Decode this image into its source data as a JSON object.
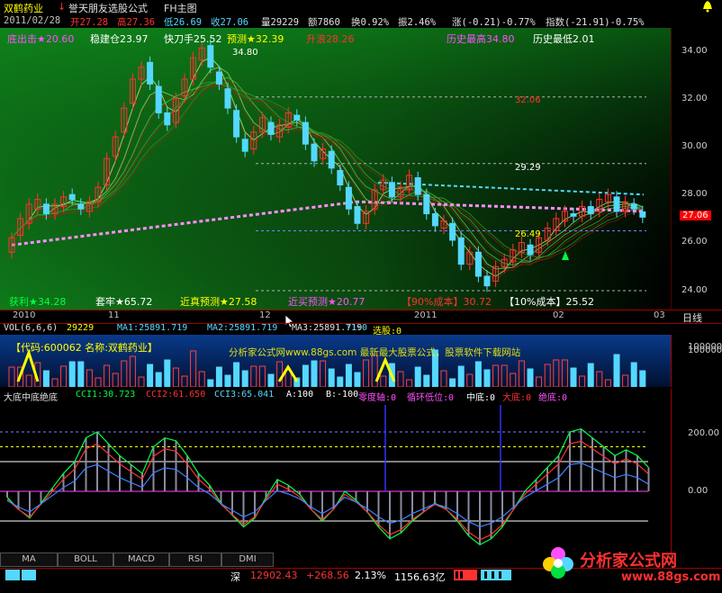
{
  "top": {
    "stock_name": "双鹤药业",
    "formula_title": "誉天朋友选股公式",
    "chart_mode": "FH主图",
    "alarm_icon": "bell-icon"
  },
  "quote": {
    "date": "2011/02/28",
    "open": "开27.28",
    "high": "高27.36",
    "low": "低26.69",
    "close": "收27.06",
    "volume": "量29229",
    "amount": "额7860",
    "turnover": "换0.92%",
    "amplitude": "振2.46%",
    "change": "涨(-0.21)-0.77%",
    "index": "指数(-21.91)-0.75%"
  },
  "main_labels": {
    "l1": "底出击★20.60",
    "l2": "稳建仓23.97",
    "l3": "快刀手25.52",
    "l4": "预测★32.39",
    "l5": "升浪28.26",
    "l6": "历史最高34.80",
    "l7": "历史最低2.01",
    "peak": "34.80",
    "lvl1": "32.06",
    "lvl2": "29.29",
    "lvl3": "26.49",
    "b1": "获利★34.28",
    "b2": "套牢★65.72",
    "b3": "近真预测★27.58",
    "b4": "近买预测★20.77",
    "b5": "【90%成本】30.72",
    "b6": "【10%成本】25.52"
  },
  "price_axis": [
    "34.00",
    "32.00",
    "30.00",
    "28.00",
    "26.00",
    "24.00"
  ],
  "price_badge": "27.06",
  "dates": [
    "2010",
    "11",
    "12",
    "2011",
    "02",
    "03"
  ],
  "period": "日线",
  "vol": {
    "title": "VOL(6,6,6)",
    "val": "29229",
    "ma1": "MA1:25891.719",
    "ma2": "MA2:25891.719",
    "ma3": "MA3:25891.719",
    "t1": "T1:0",
    "sel": "选股:0",
    "info": "【代码:600062 名称:双鹤药业】",
    "watermark": "分析家公式网www.88gs.com 最新最大股票公式，股票软件下载网站",
    "axis": "100000"
  },
  "ind": {
    "title": "大底中底绝底",
    "cci1": "CCI1:30.723",
    "cci2": "CCI2:61.650",
    "cci3": "CCI3:65.041",
    "a": "A:100",
    "b": "B:-100",
    "zero": "零度轴:0",
    "cycle": "循环低位:0",
    "mid": "中底:0",
    "big": "大底:0",
    "abs": "绝底:0",
    "axis_top": "200.00",
    "axis_zero": "0.00"
  },
  "tabs": [
    "MA",
    "BOLL",
    "MACD",
    "RSI",
    "DMI"
  ],
  "status": {
    "market": "深",
    "value": "12902.43",
    "change": "+268.56",
    "pct": "2.13%",
    "amount": "1156.63亿",
    "logo": "分析家公式网",
    "url": "www.88gs.com"
  },
  "colors": {
    "red": "#ff3232",
    "cyan": "#54d8ff",
    "yellow": "#ffff00",
    "magenta": "#ff50ff",
    "green": "#00ff40"
  }
}
